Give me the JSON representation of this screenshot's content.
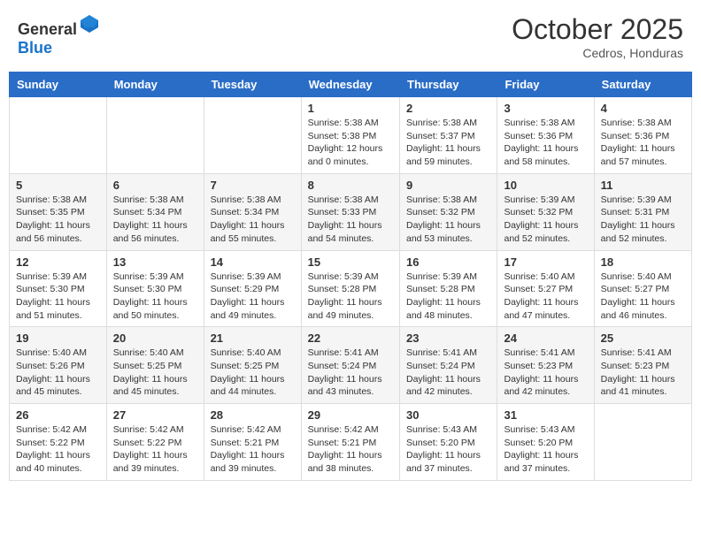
{
  "header": {
    "logo_general": "General",
    "logo_blue": "Blue",
    "month": "October 2025",
    "location": "Cedros, Honduras"
  },
  "weekdays": [
    "Sunday",
    "Monday",
    "Tuesday",
    "Wednesday",
    "Thursday",
    "Friday",
    "Saturday"
  ],
  "weeks": [
    [
      {
        "day": "",
        "info": ""
      },
      {
        "day": "",
        "info": ""
      },
      {
        "day": "",
        "info": ""
      },
      {
        "day": "1",
        "info": "Sunrise: 5:38 AM\nSunset: 5:38 PM\nDaylight: 12 hours\nand 0 minutes."
      },
      {
        "day": "2",
        "info": "Sunrise: 5:38 AM\nSunset: 5:37 PM\nDaylight: 11 hours\nand 59 minutes."
      },
      {
        "day": "3",
        "info": "Sunrise: 5:38 AM\nSunset: 5:36 PM\nDaylight: 11 hours\nand 58 minutes."
      },
      {
        "day": "4",
        "info": "Sunrise: 5:38 AM\nSunset: 5:36 PM\nDaylight: 11 hours\nand 57 minutes."
      }
    ],
    [
      {
        "day": "5",
        "info": "Sunrise: 5:38 AM\nSunset: 5:35 PM\nDaylight: 11 hours\nand 56 minutes."
      },
      {
        "day": "6",
        "info": "Sunrise: 5:38 AM\nSunset: 5:34 PM\nDaylight: 11 hours\nand 56 minutes."
      },
      {
        "day": "7",
        "info": "Sunrise: 5:38 AM\nSunset: 5:34 PM\nDaylight: 11 hours\nand 55 minutes."
      },
      {
        "day": "8",
        "info": "Sunrise: 5:38 AM\nSunset: 5:33 PM\nDaylight: 11 hours\nand 54 minutes."
      },
      {
        "day": "9",
        "info": "Sunrise: 5:38 AM\nSunset: 5:32 PM\nDaylight: 11 hours\nand 53 minutes."
      },
      {
        "day": "10",
        "info": "Sunrise: 5:39 AM\nSunset: 5:32 PM\nDaylight: 11 hours\nand 52 minutes."
      },
      {
        "day": "11",
        "info": "Sunrise: 5:39 AM\nSunset: 5:31 PM\nDaylight: 11 hours\nand 52 minutes."
      }
    ],
    [
      {
        "day": "12",
        "info": "Sunrise: 5:39 AM\nSunset: 5:30 PM\nDaylight: 11 hours\nand 51 minutes."
      },
      {
        "day": "13",
        "info": "Sunrise: 5:39 AM\nSunset: 5:30 PM\nDaylight: 11 hours\nand 50 minutes."
      },
      {
        "day": "14",
        "info": "Sunrise: 5:39 AM\nSunset: 5:29 PM\nDaylight: 11 hours\nand 49 minutes."
      },
      {
        "day": "15",
        "info": "Sunrise: 5:39 AM\nSunset: 5:28 PM\nDaylight: 11 hours\nand 49 minutes."
      },
      {
        "day": "16",
        "info": "Sunrise: 5:39 AM\nSunset: 5:28 PM\nDaylight: 11 hours\nand 48 minutes."
      },
      {
        "day": "17",
        "info": "Sunrise: 5:40 AM\nSunset: 5:27 PM\nDaylight: 11 hours\nand 47 minutes."
      },
      {
        "day": "18",
        "info": "Sunrise: 5:40 AM\nSunset: 5:27 PM\nDaylight: 11 hours\nand 46 minutes."
      }
    ],
    [
      {
        "day": "19",
        "info": "Sunrise: 5:40 AM\nSunset: 5:26 PM\nDaylight: 11 hours\nand 45 minutes."
      },
      {
        "day": "20",
        "info": "Sunrise: 5:40 AM\nSunset: 5:25 PM\nDaylight: 11 hours\nand 45 minutes."
      },
      {
        "day": "21",
        "info": "Sunrise: 5:40 AM\nSunset: 5:25 PM\nDaylight: 11 hours\nand 44 minutes."
      },
      {
        "day": "22",
        "info": "Sunrise: 5:41 AM\nSunset: 5:24 PM\nDaylight: 11 hours\nand 43 minutes."
      },
      {
        "day": "23",
        "info": "Sunrise: 5:41 AM\nSunset: 5:24 PM\nDaylight: 11 hours\nand 42 minutes."
      },
      {
        "day": "24",
        "info": "Sunrise: 5:41 AM\nSunset: 5:23 PM\nDaylight: 11 hours\nand 42 minutes."
      },
      {
        "day": "25",
        "info": "Sunrise: 5:41 AM\nSunset: 5:23 PM\nDaylight: 11 hours\nand 41 minutes."
      }
    ],
    [
      {
        "day": "26",
        "info": "Sunrise: 5:42 AM\nSunset: 5:22 PM\nDaylight: 11 hours\nand 40 minutes."
      },
      {
        "day": "27",
        "info": "Sunrise: 5:42 AM\nSunset: 5:22 PM\nDaylight: 11 hours\nand 39 minutes."
      },
      {
        "day": "28",
        "info": "Sunrise: 5:42 AM\nSunset: 5:21 PM\nDaylight: 11 hours\nand 39 minutes."
      },
      {
        "day": "29",
        "info": "Sunrise: 5:42 AM\nSunset: 5:21 PM\nDaylight: 11 hours\nand 38 minutes."
      },
      {
        "day": "30",
        "info": "Sunrise: 5:43 AM\nSunset: 5:20 PM\nDaylight: 11 hours\nand 37 minutes."
      },
      {
        "day": "31",
        "info": "Sunrise: 5:43 AM\nSunset: 5:20 PM\nDaylight: 11 hours\nand 37 minutes."
      },
      {
        "day": "",
        "info": ""
      }
    ]
  ]
}
